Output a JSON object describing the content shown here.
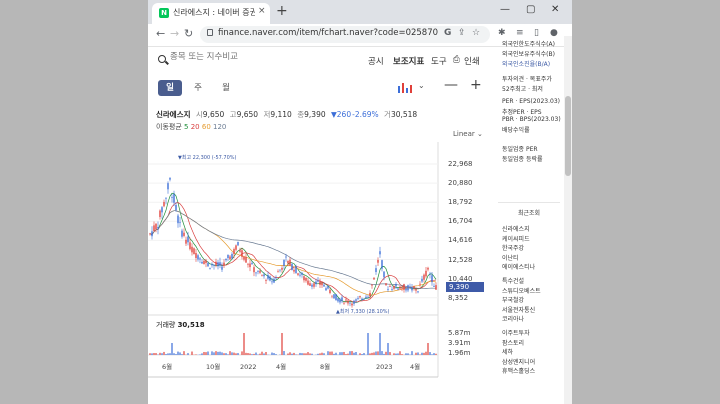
{
  "browser": {
    "tab_title": "신라에스지 : 네이버 증권",
    "tab_close": "×",
    "new_tab": "+",
    "favicon": "N",
    "url": "finance.naver.com/item/fchart.naver?code=025870",
    "win_min": "—",
    "win_max": "▢",
    "win_close": "✕",
    "nav_back": "←",
    "nav_forward": "→",
    "nav_reload": "↻"
  },
  "search": {
    "placeholder": "종목 또는 지수비교"
  },
  "menu": {
    "notice": "공시",
    "indicator": "보조지표",
    "tools": "도구",
    "print": "인쇄"
  },
  "periods": [
    {
      "label": "일",
      "active": true
    },
    {
      "label": "주",
      "active": false
    },
    {
      "label": "월",
      "active": false
    }
  ],
  "zoom": {
    "minus": "—",
    "plus": "+",
    "dropdown": "⌄"
  },
  "stock": {
    "name": "신라에스지",
    "open_label": "시",
    "open": "9,650",
    "high_label": "고",
    "high": "9,650",
    "low_label": "저",
    "low": "9,110",
    "close_label": "종",
    "close": "9,390",
    "change": "▼260",
    "change_pct": "-2.69%",
    "volume_label": "거",
    "volume": "30,518"
  },
  "moving_avg": {
    "label": "이동평균",
    "ma5": "5",
    "ma20": "20",
    "ma60": "60",
    "ma120": "120"
  },
  "scale_label": "Linear",
  "annotations": {
    "high": "▼최고 22,300 (-57.70%)",
    "low": "▲최저 7,330 (28.10%)"
  },
  "price_ticks": [
    "22,968",
    "20,880",
    "18,792",
    "16,704",
    "14,616",
    "12,528",
    "10,440",
    "8,352"
  ],
  "current_price": "9,390",
  "volume_section": {
    "label": "거래량",
    "value": "30,518",
    "ticks": [
      "5.87m",
      "3.91m",
      "1.96m"
    ]
  },
  "x_labels": [
    "6월",
    "10월",
    "2022",
    "4월",
    "8월",
    "2023",
    "4월"
  ],
  "sidebar": {
    "top_items": [
      "외국인한도주식수(A)",
      "외국인보유주식수(B)",
      "외국인소진율(B/A)"
    ],
    "mid_items": [
      "투자의견 · 목표주가",
      "52주최고 · 최저"
    ],
    "valuation": [
      "PER · EPS(2023.03)",
      "추정PER · EPS",
      "PBR · BPS(2023.03)",
      "배당수익률"
    ],
    "industry": [
      "동일업종 PER",
      "동일업종 등락률"
    ],
    "recent_title": "최근조회",
    "recent": [
      "신라에스지",
      "케이씨피드",
      "한국주강",
      "이난티",
      "에이에스티나",
      "특수건설",
      "스튜디오베스트",
      "부국철강",
      "서울전자통신",
      "코리아나",
      "이주트투자",
      "팜스토리",
      "세하",
      "삼성엔지니어",
      "휴맥스홀딩스"
    ]
  },
  "colors": {
    "up": "#e0403a",
    "down": "#3c6ed8",
    "accent": "#4a5d8e",
    "ma5": "#1f8f3a",
    "ma20": "#d94040",
    "ma60": "#e59b2e",
    "ma120": "#6b7c93"
  }
}
